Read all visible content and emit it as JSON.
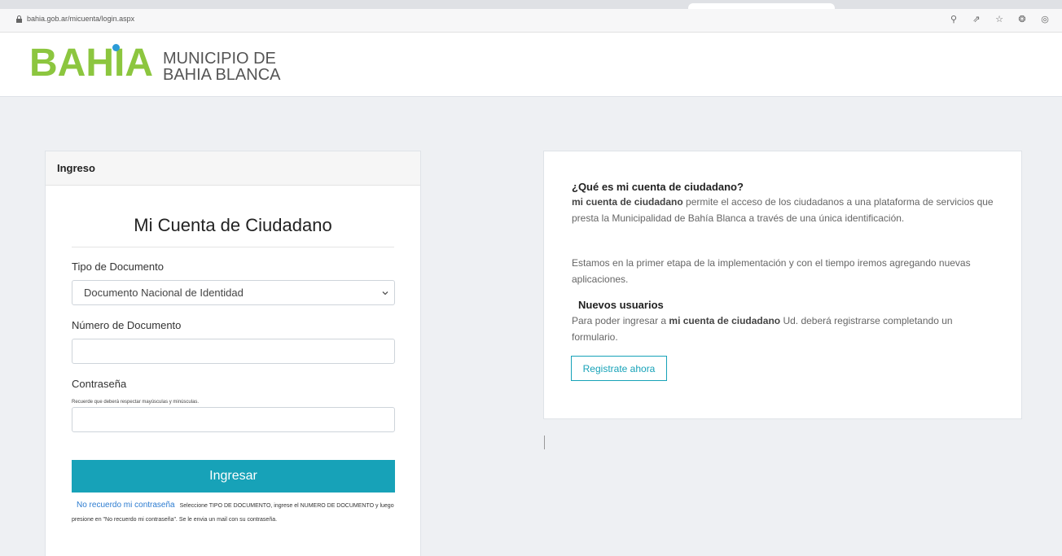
{
  "browser": {
    "url": "bahia.gob.ar/micuenta/login.aspx",
    "icons": [
      "zoom-icon",
      "share-icon",
      "star-icon",
      "extension-icon",
      "extension-icon"
    ]
  },
  "header": {
    "logo_word": "BAHIA",
    "logo_sub_line1": "MUNICIPIO DE",
    "logo_sub_line2": "BAHIA BLANCA"
  },
  "login": {
    "card_title": "Ingreso",
    "title": "Mi Cuenta de Ciudadano",
    "doc_type_label": "Tipo de Documento",
    "doc_type_selected": "Documento Nacional de Identidad",
    "doc_number_label": "Número de Documento",
    "doc_number_value": "",
    "password_label": "Contraseña",
    "password_hint": "Recuerde que deberá respectar mayúsculas y minúsculas.",
    "password_value": "",
    "submit_label": "Ingresar",
    "forgot_link": "No recuerdo mi contraseña",
    "forgot_text": "Seleccione TIPO DE DOCUMENTO, ingrese el NUMERO DE DOCUMENTO y luego presione en \"No recuerdo mi contraseña\". Se le envia un mail con su contraseña."
  },
  "info": {
    "question": "¿Qué es mi cuenta de ciudadano?",
    "p1_bold": "mi cuenta de ciudadano",
    "p1_text": " permite el acceso de los ciudadanos a una plataforma de servicios que presta la Municipalidad de Bahía Blanca a través de una única identificación.",
    "p2": "Estamos en la primer etapa de la implementación y con el tiempo iremos agregando nuevas aplicaciones.",
    "new_users_title": "Nuevos usuarios",
    "p3_prefix": "Para poder ingresar a ",
    "p3_bold": "mi cuenta de ciudadano",
    "p3_suffix": " Ud. deberá registrarse completando un formulario.",
    "register_label": "Registrate ahora"
  },
  "colors": {
    "brand_green": "#8cc63f",
    "brand_blue": "#2b9bd7",
    "accent_teal": "#17a2b8",
    "link_blue": "#2b7bd0"
  }
}
